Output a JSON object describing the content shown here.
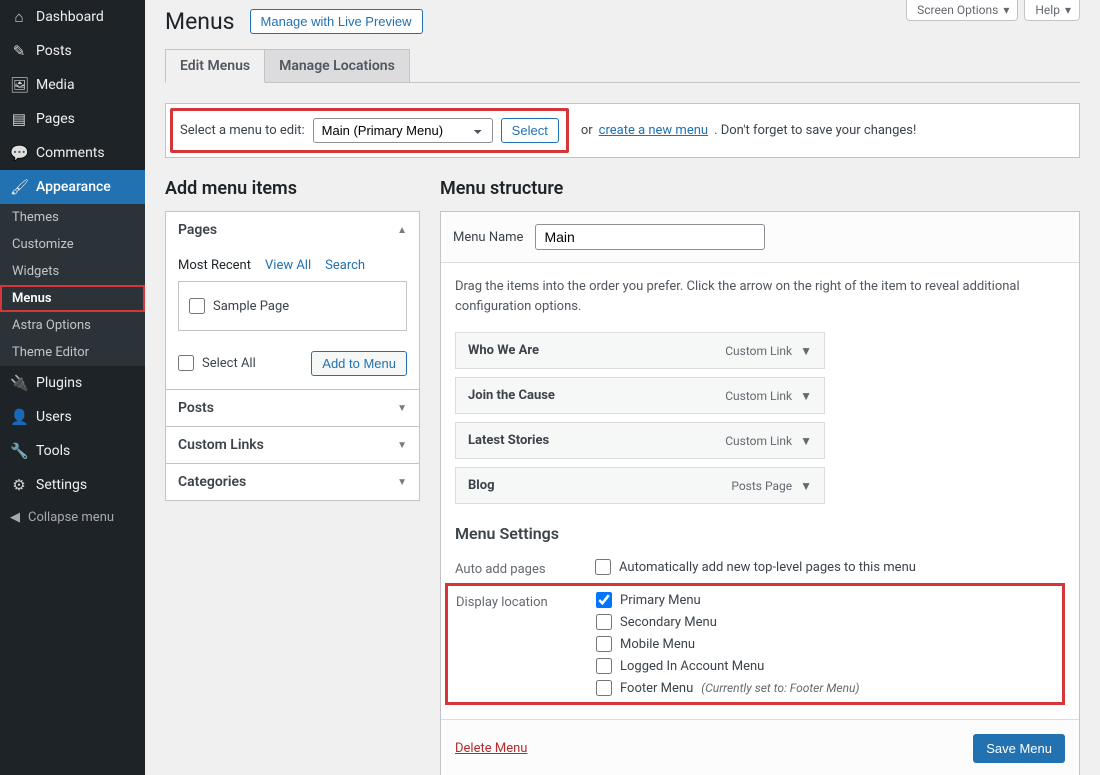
{
  "sidebar": {
    "items": [
      {
        "label": "Dashboard",
        "icon": "⌂"
      },
      {
        "label": "Posts",
        "icon": "✎"
      },
      {
        "label": "Media",
        "icon": "🖼"
      },
      {
        "label": "Pages",
        "icon": "▤"
      },
      {
        "label": "Comments",
        "icon": "💬"
      },
      {
        "label": "Appearance",
        "icon": "🖌",
        "active": true
      },
      {
        "label": "Plugins",
        "icon": "🔌"
      },
      {
        "label": "Users",
        "icon": "👤"
      },
      {
        "label": "Tools",
        "icon": "🔧"
      },
      {
        "label": "Settings",
        "icon": "⚙"
      }
    ],
    "subitems": [
      {
        "label": "Themes"
      },
      {
        "label": "Customize"
      },
      {
        "label": "Widgets"
      },
      {
        "label": "Menus",
        "selected": true
      },
      {
        "label": "Astra Options"
      },
      {
        "label": "Theme Editor"
      }
    ],
    "collapse": "Collapse menu"
  },
  "top": {
    "screen_options": "Screen Options",
    "help": "Help"
  },
  "page_title": "Menus",
  "live_preview": "Manage with Live Preview",
  "tabs": {
    "edit": "Edit Menus",
    "locations": "Manage Locations"
  },
  "select_bar": {
    "label": "Select a menu to edit:",
    "option": "Main (Primary Menu)",
    "button": "Select",
    "or": "or",
    "create": "create a new menu",
    "tail": ". Don't forget to save your changes!"
  },
  "sections": {
    "add_title": "Add menu items",
    "struct_title": "Menu structure"
  },
  "pages_panel": {
    "title": "Pages",
    "subtabs": {
      "recent": "Most Recent",
      "all": "View All",
      "search": "Search"
    },
    "sample": "Sample Page",
    "select_all": "Select All",
    "add": "Add to Menu"
  },
  "other_panels": [
    "Posts",
    "Custom Links",
    "Categories"
  ],
  "structure": {
    "name_label": "Menu Name",
    "name_value": "Main",
    "hint": "Drag the items into the order you prefer. Click the arrow on the right of the item to reveal additional configuration options.",
    "items": [
      {
        "title": "Who We Are",
        "type": "Custom Link"
      },
      {
        "title": "Join the Cause",
        "type": "Custom Link"
      },
      {
        "title": "Latest Stories",
        "type": "Custom Link"
      },
      {
        "title": "Blog",
        "type": "Posts Page"
      }
    ]
  },
  "settings": {
    "heading": "Menu Settings",
    "auto_label": "Auto add pages",
    "auto_opt": "Automatically add new top-level pages to this menu",
    "disp_label": "Display location",
    "locations": [
      {
        "label": "Primary Menu",
        "checked": true
      },
      {
        "label": "Secondary Menu",
        "checked": false
      },
      {
        "label": "Mobile Menu",
        "checked": false
      },
      {
        "label": "Logged In Account Menu",
        "checked": false
      },
      {
        "label": "Footer Menu",
        "checked": false,
        "note": "(Currently set to: Footer Menu)"
      }
    ]
  },
  "footer": {
    "delete": "Delete Menu",
    "save": "Save Menu"
  }
}
